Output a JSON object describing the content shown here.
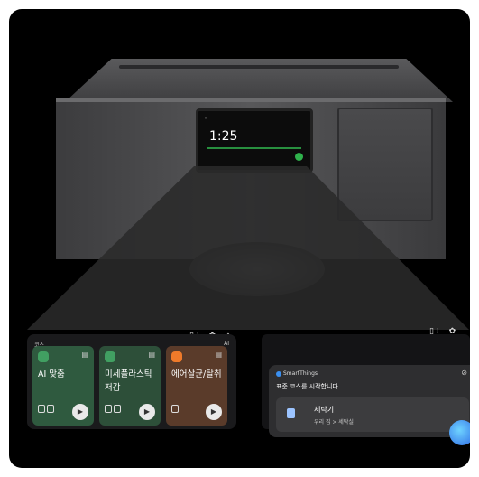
{
  "mini_display": {
    "time": "1:25"
  },
  "left_panel": {
    "header": "코스",
    "header_right": "AI",
    "cards": [
      {
        "title": "AI 맞춤",
        "icon": "ai-icon",
        "color": "#2f5a3f"
      },
      {
        "title": "미세플라스틱\n저감",
        "icon": "leaf-icon",
        "color": "#2d4f39"
      },
      {
        "title": "에어살균/탈취",
        "icon": "air-icon",
        "color": "#5a3b2a"
      }
    ],
    "play_label": "▶"
  },
  "toolbar": {
    "icons": [
      "wifi-icon",
      "settings-icon",
      "home-icon"
    ]
  },
  "dialog": {
    "app_name": "SmartThings",
    "message": "표준 코스를 시작합니다.",
    "device_name": "세탁기",
    "device_location": "우리 집 > 세탁실"
  },
  "colors": {
    "accent": "#3a8ff0",
    "card_green": "#2f5a3f",
    "card_orange": "#5a3b2a"
  }
}
